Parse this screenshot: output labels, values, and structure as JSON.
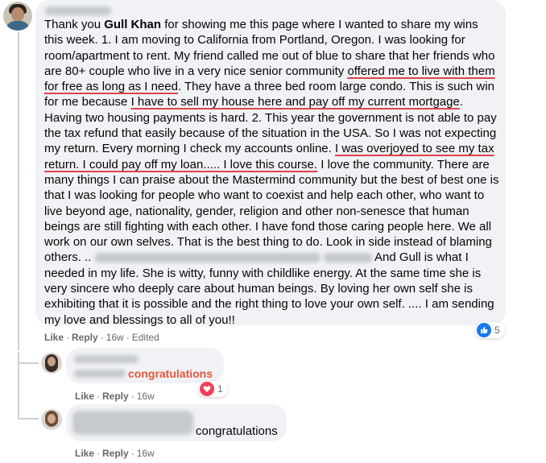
{
  "post": {
    "p1": "Thank you ",
    "tagged_name": "Gull Khan",
    "p2": " for showing me this page where I wanted to share my wins this week. 1. I am moving to California from Portland, Oregon. I was looking for room/apartment to rent. My friend called me out of blue to share that her friends who are 80+ couple who live in a very nice senior community ",
    "u1": "offered me to live with them for free as long as I need",
    "p3": ". They have a three bed room large condo. This is such win for me because ",
    "u2": "I have to sell my house here and pay off my current mortgage",
    "p4": ". Having two housing payments is hard. 2. This year the government is not able to pay the tax refund that easily because of the situation in the USA. So I was not expecting my return. Every morning I check my accounts online. ",
    "u3": "I was overjoyed to see my tax return. I could pay off my loan..... I love this course.",
    "p5": " I love the community. There are many things I can praise about the Mastermind community but the best of best one is that I was looking for people who want to coexist and help each other, who want to live beyond age, nationality, gender, religion and other non-senesce that human beings are still fighting with each other. I have fond those caring people here. We all work on our own selves. That is the best thing to do. Look in side instead of blaming others. .. ",
    "p6": " And Gull is what I needed in my life. She is witty, funny with childlike energy. At the same time she is very sincere who deeply care about human beings. By loving her own self she is exhibiting that it is possible and the right thing to love your own self. .... I am sending my love and blessings to all of you!!",
    "actions": {
      "like": "Like",
      "reply": "Reply",
      "time": "16w",
      "edited": "Edited",
      "sep": "·"
    },
    "reaction_count": "5"
  },
  "replies": [
    {
      "text": "congratulations",
      "actions": {
        "like": "Like",
        "reply": "Reply",
        "time": "16w",
        "sep": "·"
      },
      "reaction_count": "1",
      "text_color": "#e4573d"
    },
    {
      "text": "congratulations",
      "actions": {
        "like": "Like",
        "reply": "Reply",
        "time": "16w",
        "sep": "·"
      }
    }
  ],
  "icons": {
    "like_reaction": "thumbs-up-icon",
    "love_reaction": "heart-icon"
  },
  "colors": {
    "bubble_bg": "#f0f2f5",
    "underline": "#e0424c",
    "like_blue": "#1877f2",
    "love_red": "#f33e58",
    "meta_gray": "#65676b",
    "tag_orange": "#e4573d"
  }
}
